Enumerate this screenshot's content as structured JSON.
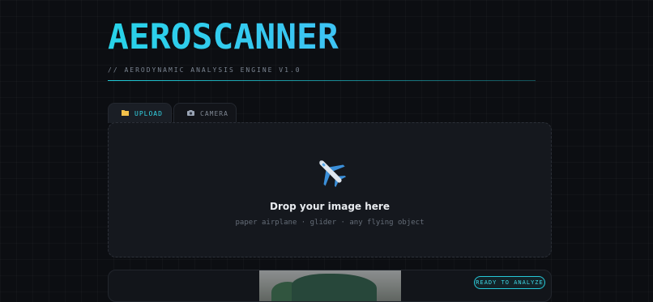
{
  "header": {
    "title": "AEROSCANNER",
    "subtitle": "// AERODYNAMIC ANALYSIS ENGINE V1.0"
  },
  "tabs": [
    {
      "label": "UPLOAD",
      "icon": "folder-icon",
      "active": true
    },
    {
      "label": "CAMERA",
      "icon": "camera-icon",
      "active": false
    }
  ],
  "dropzone": {
    "icon": "airplane-icon",
    "title": "Drop your image here",
    "hint": "paper airplane · glider · any flying object"
  },
  "preview": {
    "status_badge": "READY TO ANALYZE"
  },
  "colors": {
    "accent": "#27d3e8",
    "background": "#0c0e12",
    "panel": "#15181e"
  }
}
